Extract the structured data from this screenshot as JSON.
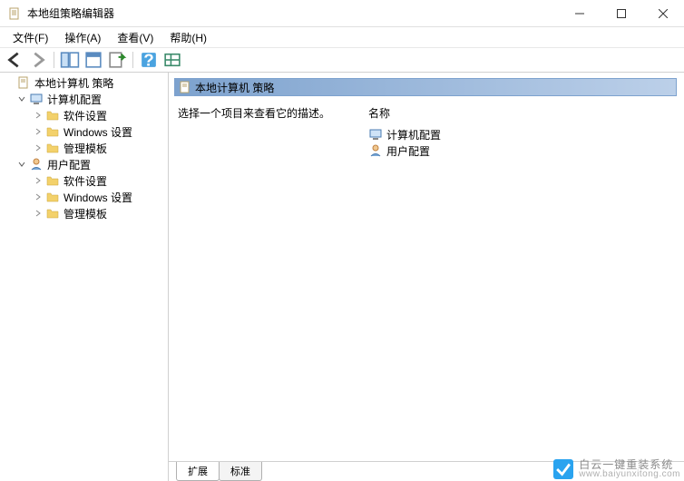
{
  "window": {
    "title": "本地组策略编辑器"
  },
  "menu": {
    "file": "文件(F)",
    "action": "操作(A)",
    "view": "查看(V)",
    "help": "帮助(H)"
  },
  "tree": {
    "root": "本地计算机 策略",
    "computer_config": "计算机配置",
    "software_settings": "软件设置",
    "windows_settings": "Windows 设置",
    "admin_templates": "管理模板",
    "user_config": "用户配置"
  },
  "content": {
    "header": "本地计算机 策略",
    "description": "选择一个项目来查看它的描述。",
    "name_col": "名称",
    "items": {
      "computer_config": "计算机配置",
      "user_config": "用户配置"
    }
  },
  "tabs": {
    "extended": "扩展",
    "standard": "标准"
  },
  "watermark": {
    "main": "白云一键重装系统",
    "url": "www.baiyunxitong.com"
  }
}
